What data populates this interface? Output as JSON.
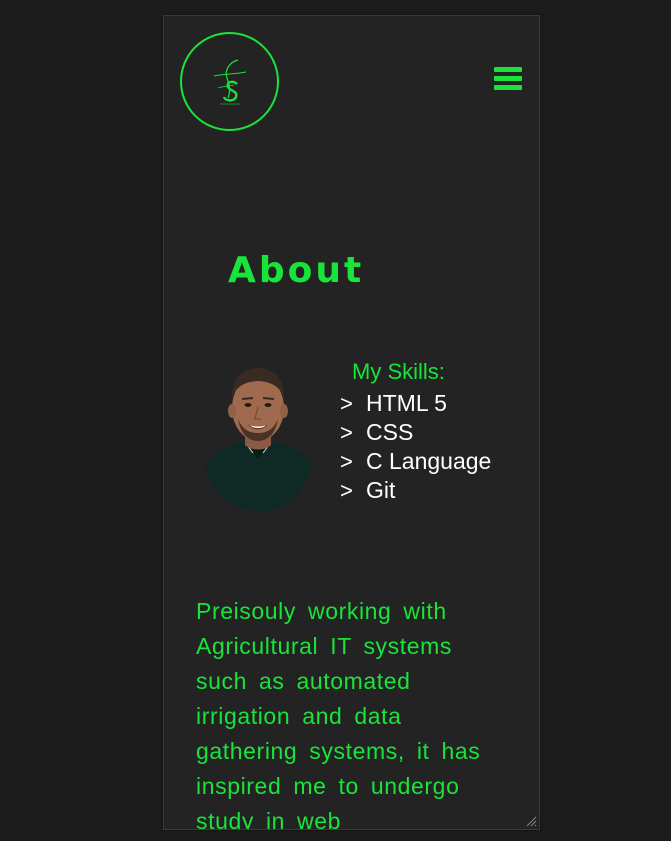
{
  "header": {
    "logo_icon": "signature-logo-icon",
    "menu_icon": "hamburger-menu-icon"
  },
  "about": {
    "title": "About"
  },
  "profile": {
    "avatar_icon": "profile-photo"
  },
  "skills": {
    "heading": "My Skills:",
    "bullet": ">",
    "items": [
      "HTML 5",
      "CSS",
      "C Language",
      "Git"
    ]
  },
  "bio": {
    "text": "Preisouly working with Agricultural IT systems such as automated irrigation and data gathering systems, it has inspired me to undergo study in web"
  },
  "colors": {
    "background": "#1c1c1c",
    "panel": "#232323",
    "accent": "#19e43a",
    "text": "#ffffff"
  }
}
